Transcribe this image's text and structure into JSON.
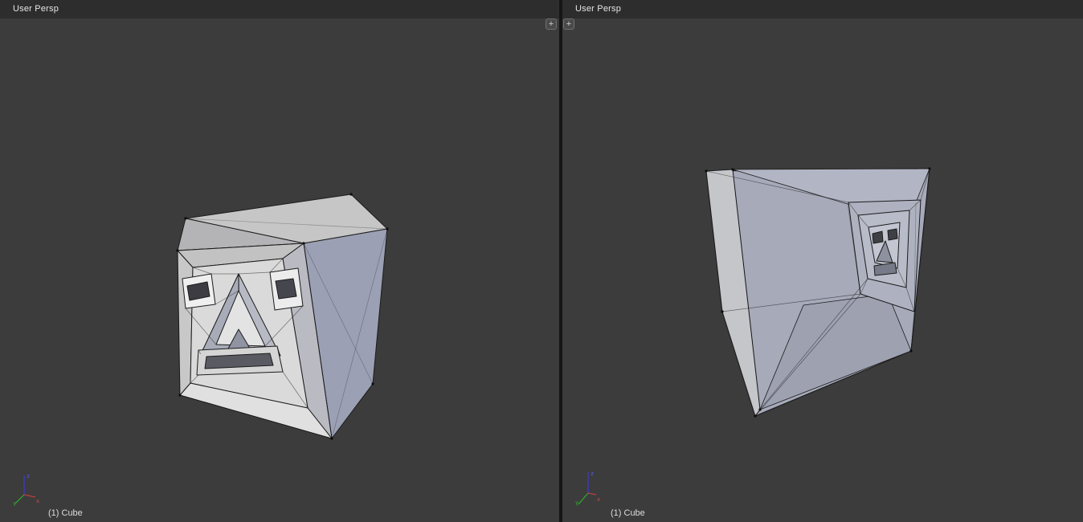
{
  "viewports": [
    {
      "view_label": "User Persp",
      "object_label": "(1) Cube"
    },
    {
      "view_label": "User Persp",
      "object_label": "(1) Cube"
    }
  ],
  "icons": {
    "expand_region": "+",
    "axis_gizmo": "xyz-mini-axis"
  },
  "axis_labels": {
    "x": "x",
    "y": "y",
    "z": "z"
  },
  "colors": {
    "viewport_background": "#3c3c3c",
    "header_background": "#2d2d2d",
    "divider": "#161616",
    "label_text": "#e6e6e6",
    "mesh_face_light": "#d9d9d9",
    "mesh_face_shaded": "#9ba0b4",
    "mesh_wire": "#1c1c1c",
    "axis_x": "#c23c3c",
    "axis_y": "#2fae2f",
    "axis_z": "#3b3bd6"
  }
}
